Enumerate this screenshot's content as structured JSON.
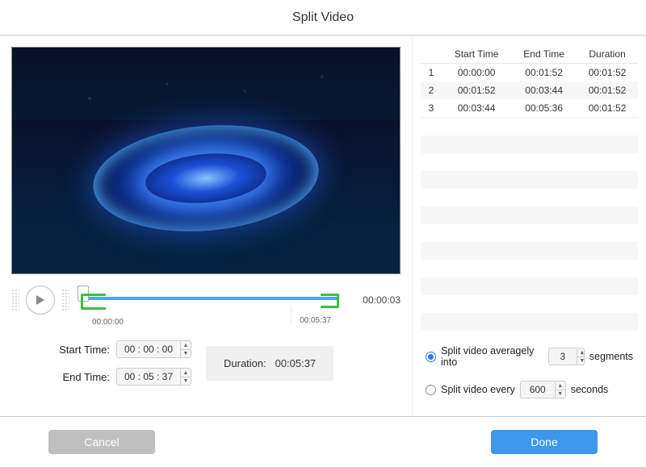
{
  "title": "Split Video",
  "timeline": {
    "elapsed": "00:00:03",
    "start_under": "00:00:00",
    "end_under": "00:05:37"
  },
  "controls": {
    "start_label": "Start Time:",
    "end_label": "End Time:",
    "start_value": "00 : 00 : 00",
    "end_value": "00 : 05 : 37",
    "duration_label": "Duration:",
    "duration_value": "00:05:37"
  },
  "segments_table": {
    "headers": [
      "",
      "Start Time",
      "End Time",
      "Duration"
    ],
    "rows": [
      {
        "idx": "1",
        "start": "00:00:00",
        "end": "00:01:52",
        "dur": "00:01:52"
      },
      {
        "idx": "2",
        "start": "00:01:52",
        "end": "00:03:44",
        "dur": "00:01:52"
      },
      {
        "idx": "3",
        "start": "00:03:44",
        "end": "00:05:36",
        "dur": "00:01:52"
      }
    ]
  },
  "options": {
    "avg_label_pre": "Split video averagely into",
    "avg_value": "3",
    "avg_label_post": "segments",
    "every_label_pre": "Split video every",
    "every_value": "600",
    "every_label_post": "seconds",
    "selected": "avg"
  },
  "footer": {
    "cancel": "Cancel",
    "done": "Done"
  }
}
